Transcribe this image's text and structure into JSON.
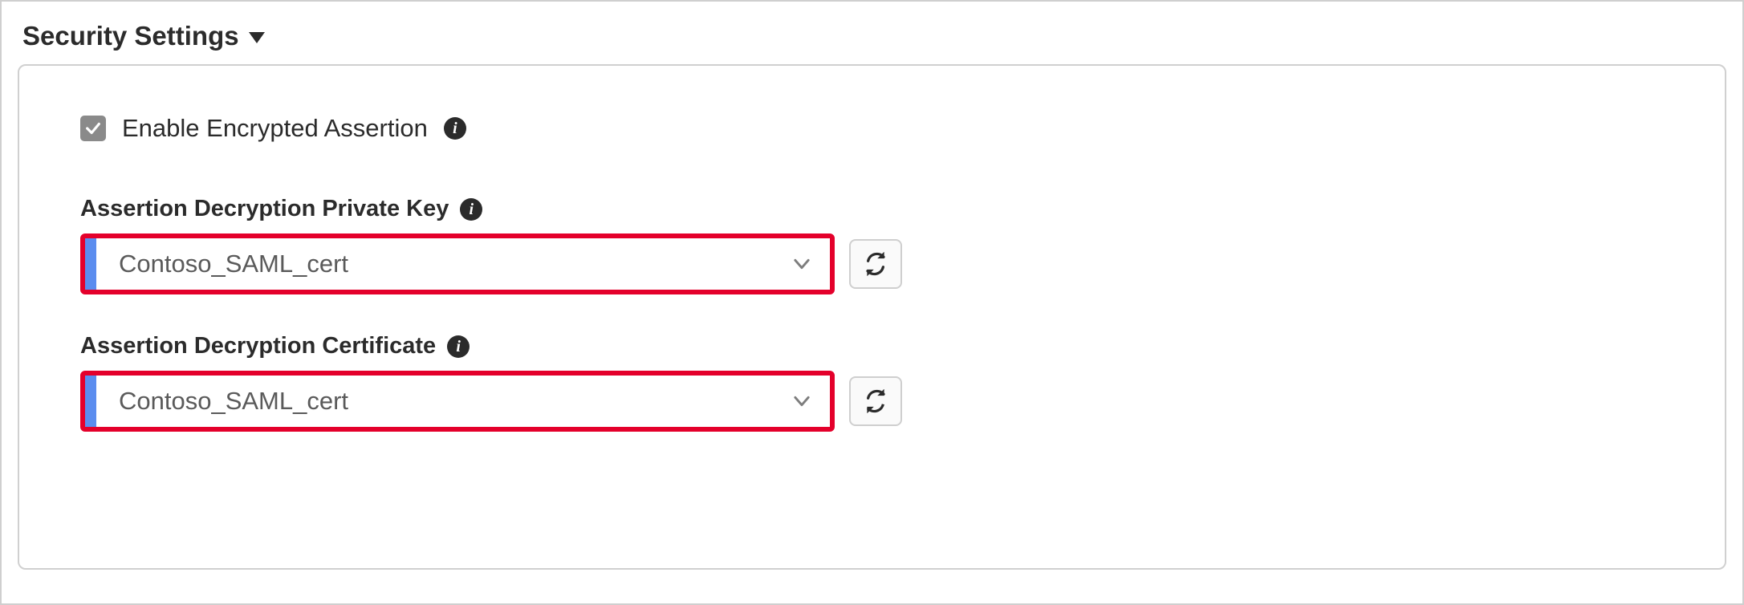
{
  "section": {
    "title": "Security Settings"
  },
  "checkbox": {
    "checked": true,
    "label": "Enable Encrypted Assertion"
  },
  "fields": {
    "privateKey": {
      "label": "Assertion Decryption Private Key",
      "value": "Contoso_SAML_cert"
    },
    "certificate": {
      "label": "Assertion Decryption Certificate",
      "value": "Contoso_SAML_cert"
    }
  },
  "colors": {
    "highlightBorder": "#e4002b",
    "stripe": "#5b8def",
    "checkboxBg": "#8a8a8a"
  }
}
